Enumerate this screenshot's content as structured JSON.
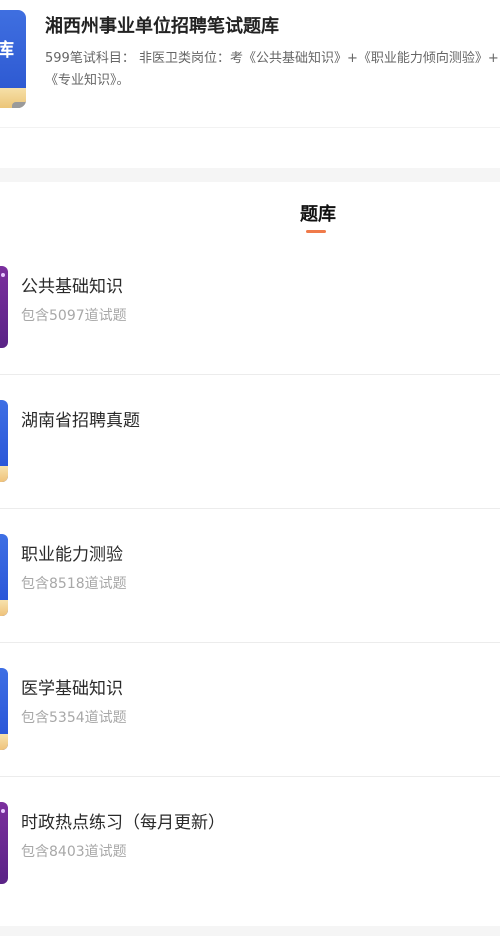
{
  "product": {
    "cover_text": "库",
    "title": "湘西州事业单位招聘笔试题库",
    "description": "599笔试科目： 非医卫类岗位：考《公共基础知识》+《职业能力倾向测验》+《专业知识》。"
  },
  "section": {
    "title": "题库",
    "accent_color": "#f07a4a"
  },
  "items": [
    {
      "name": "公共基础知识",
      "count": "包含5097道试题",
      "thumb_color": "purple"
    },
    {
      "name": "湖南省招聘真题",
      "count": "",
      "thumb_color": "blue"
    },
    {
      "name": "职业能力测验",
      "count": "包含8518道试题",
      "thumb_color": "blue"
    },
    {
      "name": "医学基础知识",
      "count": "包含5354道试题",
      "thumb_color": "blue"
    },
    {
      "name": "时政热点练习（每月更新）",
      "count": "包含8403道试题",
      "thumb_color": "purple"
    }
  ]
}
